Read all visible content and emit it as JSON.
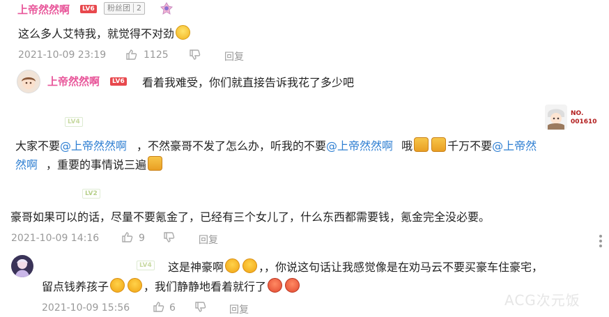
{
  "comment1": {
    "username": "上帝然然啊",
    "level": "LV6",
    "fan_badge": {
      "label": "粉丝团",
      "value": "2"
    },
    "text": "这么多人艾特我，就觉得不对劲",
    "time": "2021-10-09 23:19",
    "likes": "1125",
    "reply": "回复",
    "reply_preview": {
      "username": "上帝然然啊",
      "level": "LV6",
      "text": "看着我难受，你们就直接告诉我花了多少吧"
    }
  },
  "comment2": {
    "level": "LV4",
    "id_label": "NO.",
    "id_number": "001610",
    "text_parts": {
      "a": "大家不要",
      "mention1": "@上帝然然啊",
      "b": "，不然豪哥不发了怎么办，听我的不要",
      "mention2": "@上帝然然啊",
      "c": "哦",
      "d": "千万不要",
      "mention3a": "@上帝然",
      "mention3b": "然啊",
      "e": "，重要的事情说三遍"
    }
  },
  "comment3": {
    "level": "LV2",
    "text": "豪哥如果可以的话，尽量不要氪金了，已经有三个女儿了，什么东西都需要钱，氪金完全没必要。",
    "time": "2021-10-09 14:16",
    "likes": "9",
    "reply": "回复"
  },
  "comment4": {
    "level": "LV4",
    "text_a": "这是神豪啊",
    "text_b": "，，你说这句话让我感觉像是在劝马云不要买豪车住豪宅，",
    "text_c": "留点钱养孩子",
    "text_d": "，我们静静地看着就行了",
    "time": "2021-10-09 15:56",
    "likes": "6",
    "reply": "回复"
  },
  "watermark": "ACG次元饭",
  "icons": {
    "like": "thumbs-up-icon",
    "dislike": "thumbs-down-icon",
    "more": "more-vertical-icon"
  }
}
